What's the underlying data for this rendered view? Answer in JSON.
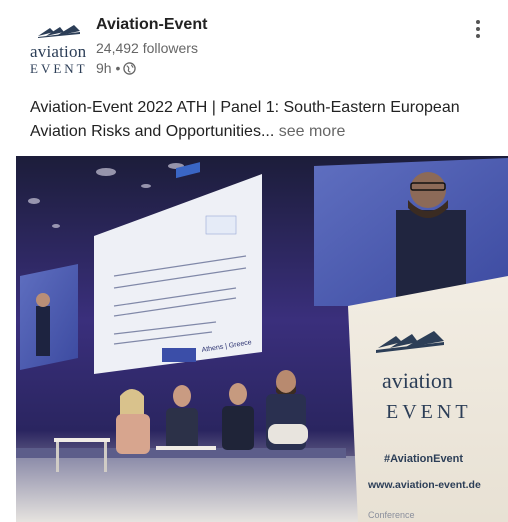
{
  "author": {
    "name": "Aviation-Event",
    "followers": "24,492 followers",
    "time": "9h •",
    "visibility_icon": "globe-icon",
    "logo_line1": "aviation",
    "logo_line2": "EVENT"
  },
  "post": {
    "text_line1": "Aviation-Event 2022 ATH | Panel 1: South-Eastern European",
    "text_line2": "Aviation Risks and Opportunities",
    "ellipsis": "...",
    "see_more": " see more"
  },
  "image": {
    "banner_line1": "aviation",
    "banner_line2": "EVENT",
    "banner_hashtag": "#AviationEvent",
    "banner_url": "www.aviation-event.de",
    "banner_footer": "Conference",
    "slide_location": "Athens | Greece"
  },
  "colors": {
    "brand_navy": "#2c3e57",
    "stage_purple": "#4b3b8f"
  }
}
